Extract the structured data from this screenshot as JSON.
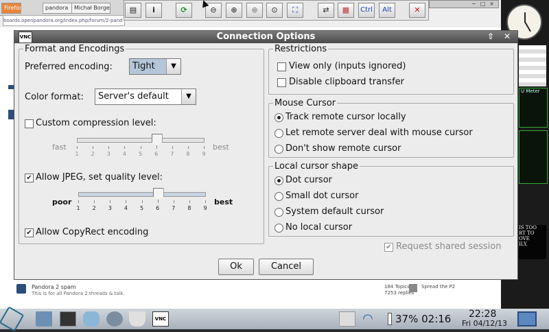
{
  "background": {
    "tabs": [
      "Firefox",
      "pandora",
      "Michał Borgen"
    ],
    "url": "boards.openpandora.org/index.php/forum/2-pand",
    "forum_title": "Pandora 2 spam",
    "forum_desc": "This is for all Pandora 2 threads & talk.",
    "topics": "184 Topics",
    "replies": "7253 replies",
    "last_post": "Spread the P2",
    "right_text": [
      "IS TOO",
      "RT TO",
      "OVE",
      "ILY."
    ],
    "meter": "U Meter"
  },
  "vnc_toolbar": {
    "buttons": [
      "options-icon",
      "info-icon",
      "refresh-icon",
      "zoom-out-icon",
      "zoom-in-icon",
      "zoom-100-icon",
      "zoom-fit-icon",
      "fullscreen-icon",
      "transfer-icon",
      "keyboard-icon",
      "ctrl-key",
      "alt-key",
      "disconnect-icon"
    ],
    "ctrl_label": "Ctrl",
    "alt_label": "Alt"
  },
  "dialog": {
    "title": "Connection Options",
    "logo_text": "VNC",
    "format": {
      "heading": "Format and Encodings",
      "preferred_label": "Preferred encoding:",
      "preferred_value": "Tight",
      "color_label": "Color format:",
      "color_value": "Server's default",
      "custom_compression_label": "Custom compression level:",
      "custom_compression_checked": false,
      "compression_slider": {
        "min_label": "fast",
        "max_label": "best",
        "ticks": [
          "1",
          "2",
          "3",
          "4",
          "5",
          "6",
          "7",
          "8",
          "9"
        ],
        "value": 6,
        "enabled": false
      },
      "jpeg_label": "Allow JPEG, set quality level:",
      "jpeg_checked": true,
      "quality_slider": {
        "min_label": "poor",
        "max_label": "best",
        "ticks": [
          "1",
          "2",
          "3",
          "4",
          "5",
          "6",
          "7",
          "8",
          "9"
        ],
        "value": 6,
        "enabled": true
      },
      "copyrect_label": "Allow CopyRect encoding",
      "copyrect_checked": true
    },
    "restrictions": {
      "heading": "Restrictions",
      "view_only_label": "View only (inputs ignored)",
      "view_only_checked": false,
      "clipboard_label": "Disable clipboard transfer",
      "clipboard_checked": false
    },
    "mouse_cursor": {
      "heading": "Mouse Cursor",
      "options": [
        "Track remote cursor locally",
        "Let remote server deal with mouse cursor",
        "Don't show remote cursor"
      ],
      "selected": 0
    },
    "local_cursor": {
      "heading": "Local cursor shape",
      "options": [
        "Dot cursor",
        "Small dot cursor",
        "System default cursor",
        "No local cursor"
      ],
      "selected": 0
    },
    "shared_label": "Request shared session",
    "shared_checked": true,
    "ok_label": "Ok",
    "cancel_label": "Cancel"
  },
  "taskbar": {
    "battery": "37% 02:16",
    "time": "22:28",
    "date": "Fri 04/12/13"
  }
}
